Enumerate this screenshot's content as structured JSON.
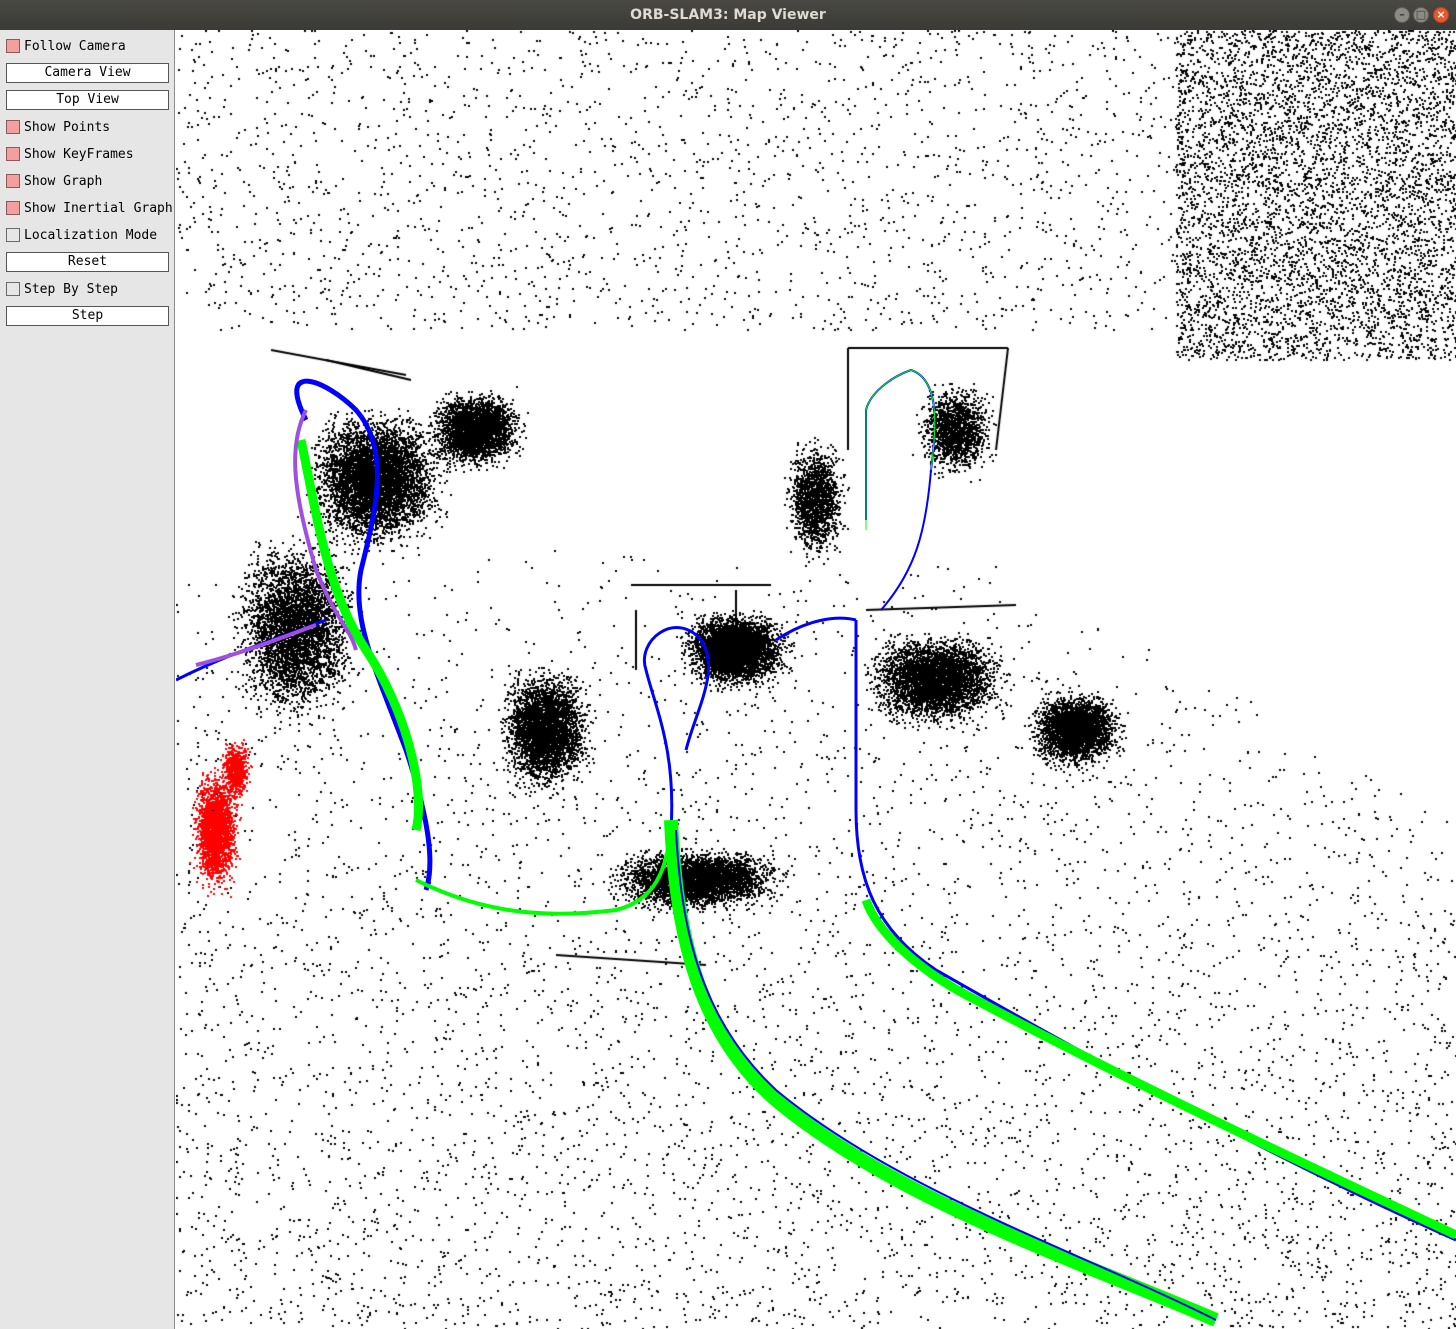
{
  "window": {
    "title": "ORB-SLAM3: Map Viewer"
  },
  "panel": {
    "follow_camera": {
      "label": "Follow Camera",
      "checked": true
    },
    "camera_view": {
      "label": "Camera View"
    },
    "top_view": {
      "label": "Top View"
    },
    "show_points": {
      "label": "Show Points",
      "checked": true
    },
    "show_keyframes": {
      "label": "Show KeyFrames",
      "checked": true
    },
    "show_graph": {
      "label": "Show Graph",
      "checked": true
    },
    "show_inertial_graph": {
      "label": "Show Inertial Graph",
      "checked": true
    },
    "localization_mode": {
      "label": "Localization Mode",
      "checked": false
    },
    "reset": {
      "label": "Reset"
    },
    "step_by_step": {
      "label": "Step By Step",
      "checked": false
    },
    "step": {
      "label": "Step"
    }
  },
  "colors": {
    "checked": "#f39f9f",
    "map_points": "#000000",
    "local_map_points": "#ff0000",
    "keyframes": "#0000ff",
    "keyframe_graph": "#00ff00",
    "inertial_keyframes": "#a050e0"
  }
}
